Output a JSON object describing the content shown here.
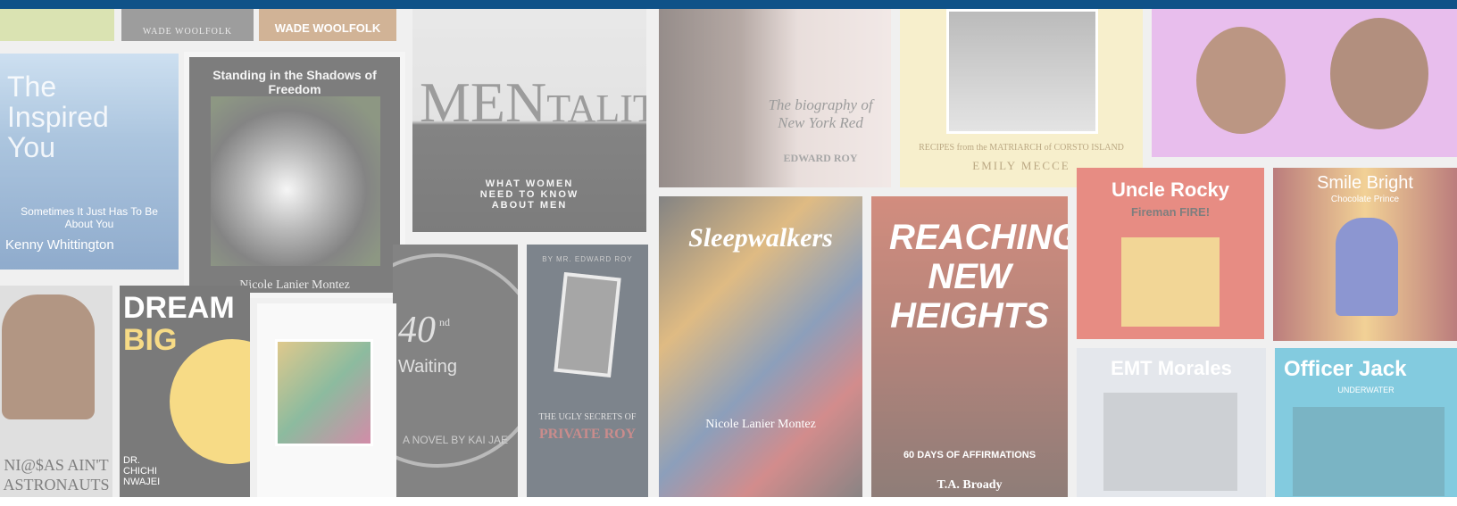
{
  "books": {
    "top_strip_1": {
      "author": "WADE WOOLFOLK"
    },
    "top_strip_2": {
      "author": "WADE WOOLFOLK"
    },
    "inspired_you": {
      "title": "The Inspired You",
      "subtitle": "Sometimes It Just Has To Be About You",
      "author": "Kenny Whittington"
    },
    "shadows_freedom": {
      "title": "Standing in the Shadows of Freedom",
      "author": "Nicole Lanier Montez"
    },
    "mentality": {
      "title_a": "MEN",
      "title_b": "TALITY",
      "subtitle": "WHAT WOMEN NEED TO KNOW ABOUT MEN"
    },
    "new_york_red": {
      "title": "The biography of New York Red",
      "author": "EDWARD ROY"
    },
    "matriarch": {
      "subtitle": "RECIPES from the MATRIARCH of CORSTO ISLAND",
      "author": "EMILY MECCE"
    },
    "princesses": {},
    "sleepwalkers": {
      "title": "Sleepwalkers",
      "author": "Nicole Lanier Montez"
    },
    "reaching": {
      "title": "REACHING NEW HEIGHTS",
      "subtitle": "60 DAYS OF AFFIRMATIONS",
      "author": "T.A. Broady"
    },
    "uncle_rocky": {
      "title": "Uncle Rocky",
      "subtitle": "Fireman FIRE!"
    },
    "smile_bright": {
      "title": "Smile Bright",
      "subtitle": "Chocolate Prince"
    },
    "emt_morales": {
      "title": "EMT Morales"
    },
    "officer_jack": {
      "title": "Officer Jack",
      "subtitle": "UNDERWATER"
    },
    "ni_as": {
      "title": "NI@$AS AIN'T ASTRONAUTS"
    },
    "dream_big": {
      "title_a": "DREAM",
      "title_b": "BIG",
      "author": "DR. CHICHI NWAJEI"
    },
    "forty_waiting": {
      "title_a": "40",
      "title_b": "nd",
      "title_c": "Waiting",
      "author": "A NOVEL BY KAI JAE"
    },
    "private_roy": {
      "top": "BY MR. EDWARD ROY",
      "title_a": "THE UGLY SECRETS OF",
      "title_b": "PRIVATE ROY"
    }
  },
  "colors": {
    "topbar": "#0f5288",
    "overlay": "rgba(255,255,255,0.42)"
  }
}
